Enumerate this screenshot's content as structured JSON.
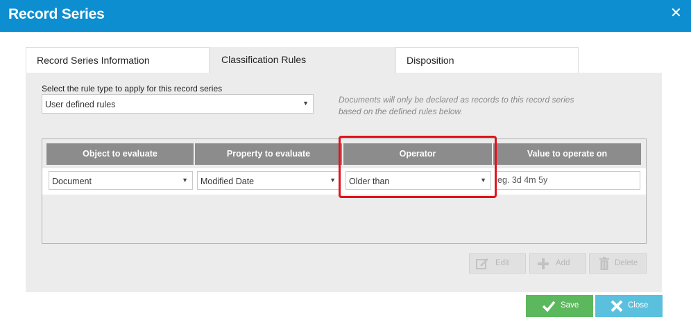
{
  "dialog": {
    "title": "Record Series"
  },
  "tabs": [
    {
      "label": "Record Series Information"
    },
    {
      "label": "Classification Rules"
    },
    {
      "label": "Disposition"
    }
  ],
  "rules": {
    "type_label": "Select the rule type to apply for this record series",
    "type_value": "User defined rules",
    "hint": "Documents will only be declared as records to this record series based on the defined rules below."
  },
  "table": {
    "headers": [
      "Object to evaluate",
      "Property to evaluate",
      "Operator",
      "Value to operate on"
    ],
    "row": {
      "object": "Document",
      "property": "Modified Date",
      "operator": "Older than",
      "value_placeholder": "eg. 3d 4m 5y"
    }
  },
  "actions": {
    "edit": "Edit",
    "add": "Add",
    "delete": "Delete"
  },
  "footer": {
    "save": "Save",
    "close": "Close"
  },
  "colors": {
    "titlebar": "#0d8ed0",
    "header_cell": "#8c8c8c",
    "save": "#5cb85c",
    "close": "#5bc0de",
    "highlight": "#e0131b"
  }
}
